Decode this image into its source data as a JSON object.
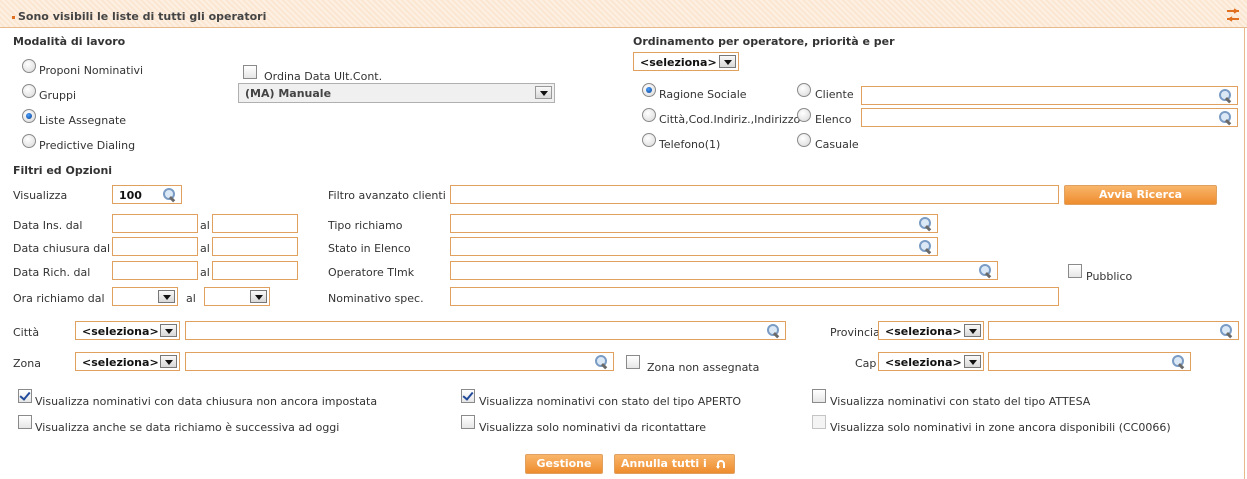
{
  "header": {
    "title": "Sono visibili le liste di tutti gli operatori"
  },
  "work_mode": {
    "title": "Modalità di lavoro",
    "options": [
      {
        "label": "Proponi Nominativi",
        "selected": false
      },
      {
        "label": "Gruppi",
        "selected": false
      },
      {
        "label": "Liste Assegnate",
        "selected": true
      },
      {
        "label": "Predictive Dialing",
        "selected": false
      }
    ],
    "order_date_label": "Ordina Data Ult.Cont.",
    "mode_select_value": "(MA) Manuale"
  },
  "ordering": {
    "title": "Ordinamento per operatore, priorità e per",
    "select_value": "<seleziona>",
    "options": [
      {
        "label": "Ragione Sociale",
        "selected": true
      },
      {
        "label": "Città,Cod.Indiriz.,Indirizzo",
        "selected": false
      },
      {
        "label": "Telefono(1)",
        "selected": false
      },
      {
        "label": "Cliente",
        "selected": false
      },
      {
        "label": "Elenco",
        "selected": false
      },
      {
        "label": "Casuale",
        "selected": false
      }
    ]
  },
  "filters": {
    "title": "Filtri ed Opzioni",
    "visualizza_label": "Visualizza",
    "visualizza_value": "100",
    "data_ins_label": "Data Ins. dal",
    "data_chiusura_label": "Data chiusura dal",
    "data_rich_label": "Data Rich. dal",
    "ora_richiamo_label": "Ora richiamo dal",
    "al_label": "al",
    "filtro_avanzato_label": "Filtro avanzato clienti",
    "avvia_ricerca_label": "Avvia Ricerca Anagrafiche",
    "tipo_richiamo_label": "Tipo richiamo",
    "stato_elenco_label": "Stato in Elenco",
    "operatore_label": "Operatore Tlmk",
    "pubblico_label": "Pubblico",
    "nominativo_label": "Nominativo spec.",
    "citta_label": "Città",
    "zona_label": "Zona",
    "provincia_label": "Provincia",
    "cap_label": "Cap",
    "select_placeholder": "<seleziona>",
    "zona_non_assegnata_label": "Zona non assegnata"
  },
  "options": [
    {
      "label": "Visualizza nominativi con data chiusura non ancora impostata",
      "checked": true,
      "disabled": false
    },
    {
      "label": "Visualizza nominativi con stato del tipo APERTO",
      "checked": true,
      "disabled": false
    },
    {
      "label": "Visualizza nominativi con stato del tipo ATTESA",
      "checked": false,
      "disabled": false
    },
    {
      "label": "Visualizza anche se data richiamo è successiva ad oggi",
      "checked": false,
      "disabled": false
    },
    {
      "label": "Visualizza solo nominativi da ricontattare",
      "checked": false,
      "disabled": false
    },
    {
      "label": "Visualizza solo nominativi in zone ancora disponibili (CC0066)",
      "checked": false,
      "disabled": true
    }
  ],
  "buttons": {
    "gestione_filtri": "Gestione filtri",
    "annulla_filtri": "Annulla tutti i filtri"
  }
}
